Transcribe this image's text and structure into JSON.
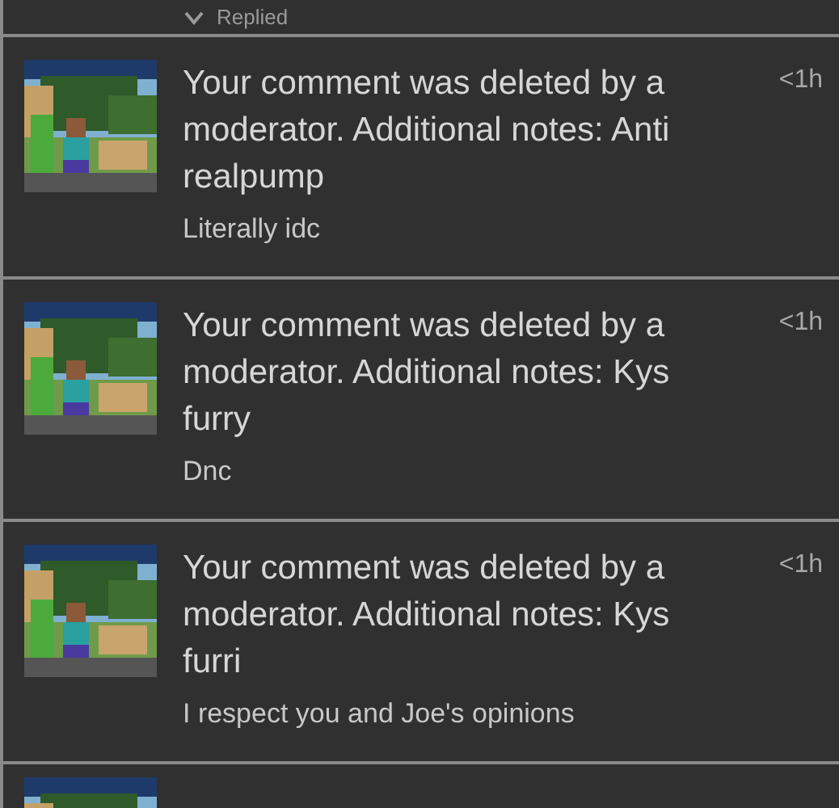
{
  "previous_item": {
    "status": "Replied"
  },
  "notifications": [
    {
      "message": "Your comment was deleted by a moderator. Additional notes: Anti realpump",
      "time": "<1h",
      "comment": "Literally idc"
    },
    {
      "message": "Your comment was deleted by a moderator. Additional notes: Kys furry",
      "time": "<1h",
      "comment": "Dnc"
    },
    {
      "message": "Your comment was deleted by a moderator. Additional notes: Kys furri",
      "time": "<1h",
      "comment": "I respect you and Joe's opinions"
    }
  ]
}
